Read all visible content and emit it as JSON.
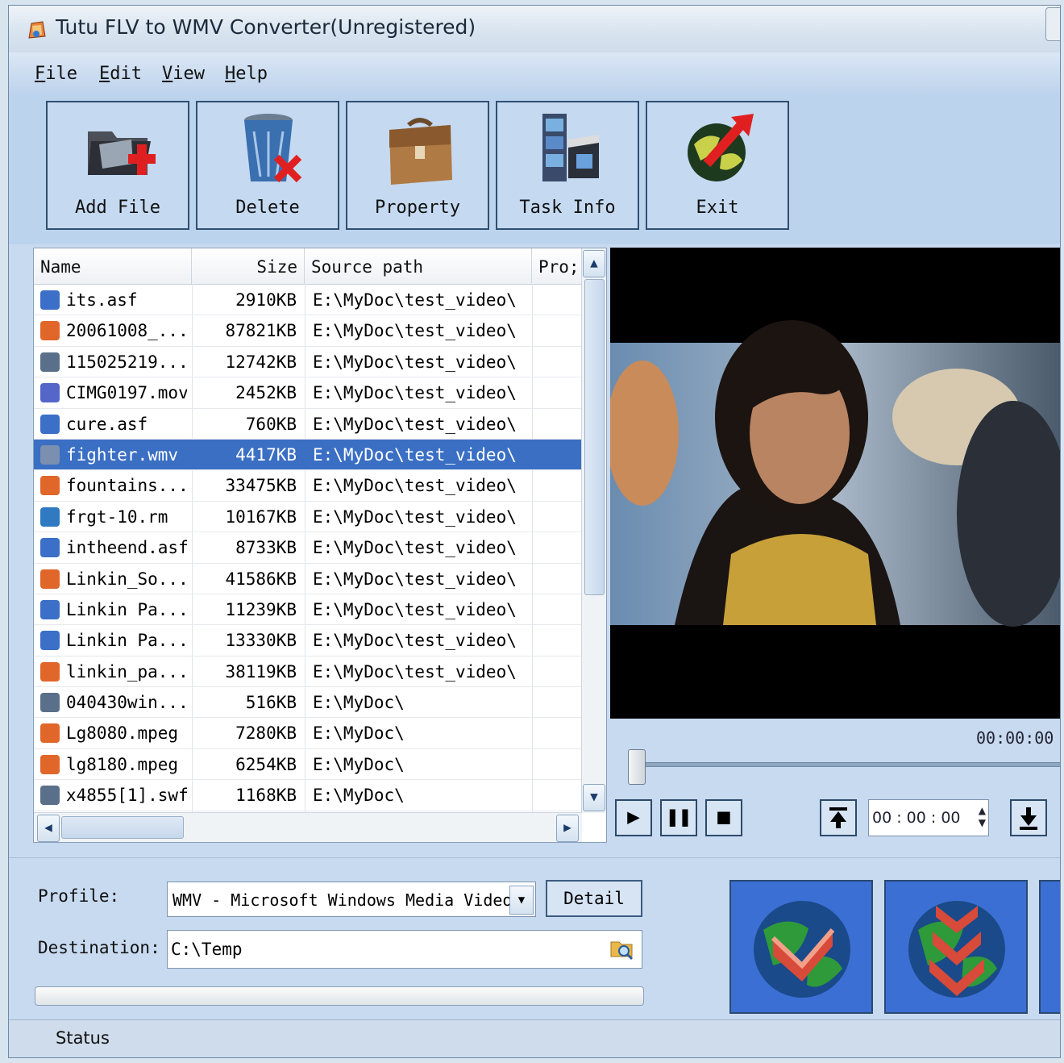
{
  "window": {
    "title": "Tutu FLV to WMV Converter(Unregistered)"
  },
  "menu": [
    {
      "accel": "F",
      "rest": "ile"
    },
    {
      "accel": "E",
      "rest": "dit"
    },
    {
      "accel": "V",
      "rest": "iew"
    },
    {
      "accel": "H",
      "rest": "elp"
    }
  ],
  "toolbar": {
    "add_file": "Add File",
    "delete": "Delete",
    "property": "Property",
    "task_info": "Task Info",
    "exit": "Exit"
  },
  "file_list": {
    "columns": [
      "Name",
      "Size",
      "Source path",
      "Pro;"
    ],
    "rows": [
      {
        "name": "its.asf",
        "size": "2910KB",
        "path": "E:\\MyDoc\\test_video\\",
        "icon": "asf-file-icon",
        "color": "#3b6fc8"
      },
      {
        "name": "20061008_...",
        "size": "87821KB",
        "path": "E:\\MyDoc\\test_video\\",
        "icon": "mpeg-file-icon",
        "color": "#e0662a"
      },
      {
        "name": "115025219...",
        "size": "12742KB",
        "path": "E:\\MyDoc\\test_video\\",
        "icon": "flash-file-icon",
        "color": "#5a6f8a"
      },
      {
        "name": "CIMG0197.mov",
        "size": "2452KB",
        "path": "E:\\MyDoc\\test_video\\",
        "icon": "mov-file-icon",
        "color": "#5566c9"
      },
      {
        "name": "cure.asf",
        "size": "760KB",
        "path": "E:\\MyDoc\\test_video\\",
        "icon": "asf-file-icon",
        "color": "#3b6fc8"
      },
      {
        "name": "fighter.wmv",
        "size": "4417KB",
        "path": "E:\\MyDoc\\test_video\\",
        "icon": "wmv-file-icon",
        "color": "#7b8fb0",
        "selected": true
      },
      {
        "name": "fountains...",
        "size": "33475KB",
        "path": "E:\\MyDoc\\test_video\\",
        "icon": "mpeg-file-icon",
        "color": "#e0662a"
      },
      {
        "name": "frgt-10.rm",
        "size": "10167KB",
        "path": "E:\\MyDoc\\test_video\\",
        "icon": "rm-file-icon",
        "color": "#2f7ac0"
      },
      {
        "name": "intheend.asf",
        "size": "8733KB",
        "path": "E:\\MyDoc\\test_video\\",
        "icon": "asf-file-icon",
        "color": "#3b6fc8"
      },
      {
        "name": "Linkin_So...",
        "size": "41586KB",
        "path": "E:\\MyDoc\\test_video\\",
        "icon": "mpeg-file-icon",
        "color": "#e0662a"
      },
      {
        "name": "Linkin Pa...",
        "size": "11239KB",
        "path": "E:\\MyDoc\\test_video\\",
        "icon": "asf-file-icon",
        "color": "#3b6fc8"
      },
      {
        "name": "Linkin Pa...",
        "size": "13330KB",
        "path": "E:\\MyDoc\\test_video\\",
        "icon": "asf-file-icon",
        "color": "#3b6fc8"
      },
      {
        "name": "linkin_pa...",
        "size": "38119KB",
        "path": "E:\\MyDoc\\test_video\\",
        "icon": "mpeg-file-icon",
        "color": "#e0662a"
      },
      {
        "name": "040430win...",
        "size": "516KB",
        "path": "E:\\MyDoc\\",
        "icon": "flash-file-icon",
        "color": "#5a6f8a"
      },
      {
        "name": "Lg8080.mpeg",
        "size": "7280KB",
        "path": "E:\\MyDoc\\",
        "icon": "mpeg-file-icon",
        "color": "#e0662a"
      },
      {
        "name": "lg8180.mpeg",
        "size": "6254KB",
        "path": "E:\\MyDoc\\",
        "icon": "mpeg-file-icon",
        "color": "#e0662a"
      },
      {
        "name": "x4855[1].swf",
        "size": "1168KB",
        "path": "E:\\MyDoc\\",
        "icon": "flash-file-icon",
        "color": "#5a6f8a"
      }
    ]
  },
  "player": {
    "elapsed": "00:00:00",
    "seek_position": 0,
    "time_input": "00 : 00 : 00"
  },
  "settings": {
    "profile_label": "Profile:",
    "profile_value": "WMV - Microsoft Windows Media Video",
    "detail_label": "Detail",
    "destination_label": "Destination:",
    "destination_value": "C:\\Temp",
    "progress": 0
  },
  "status": {
    "text": "Status"
  }
}
